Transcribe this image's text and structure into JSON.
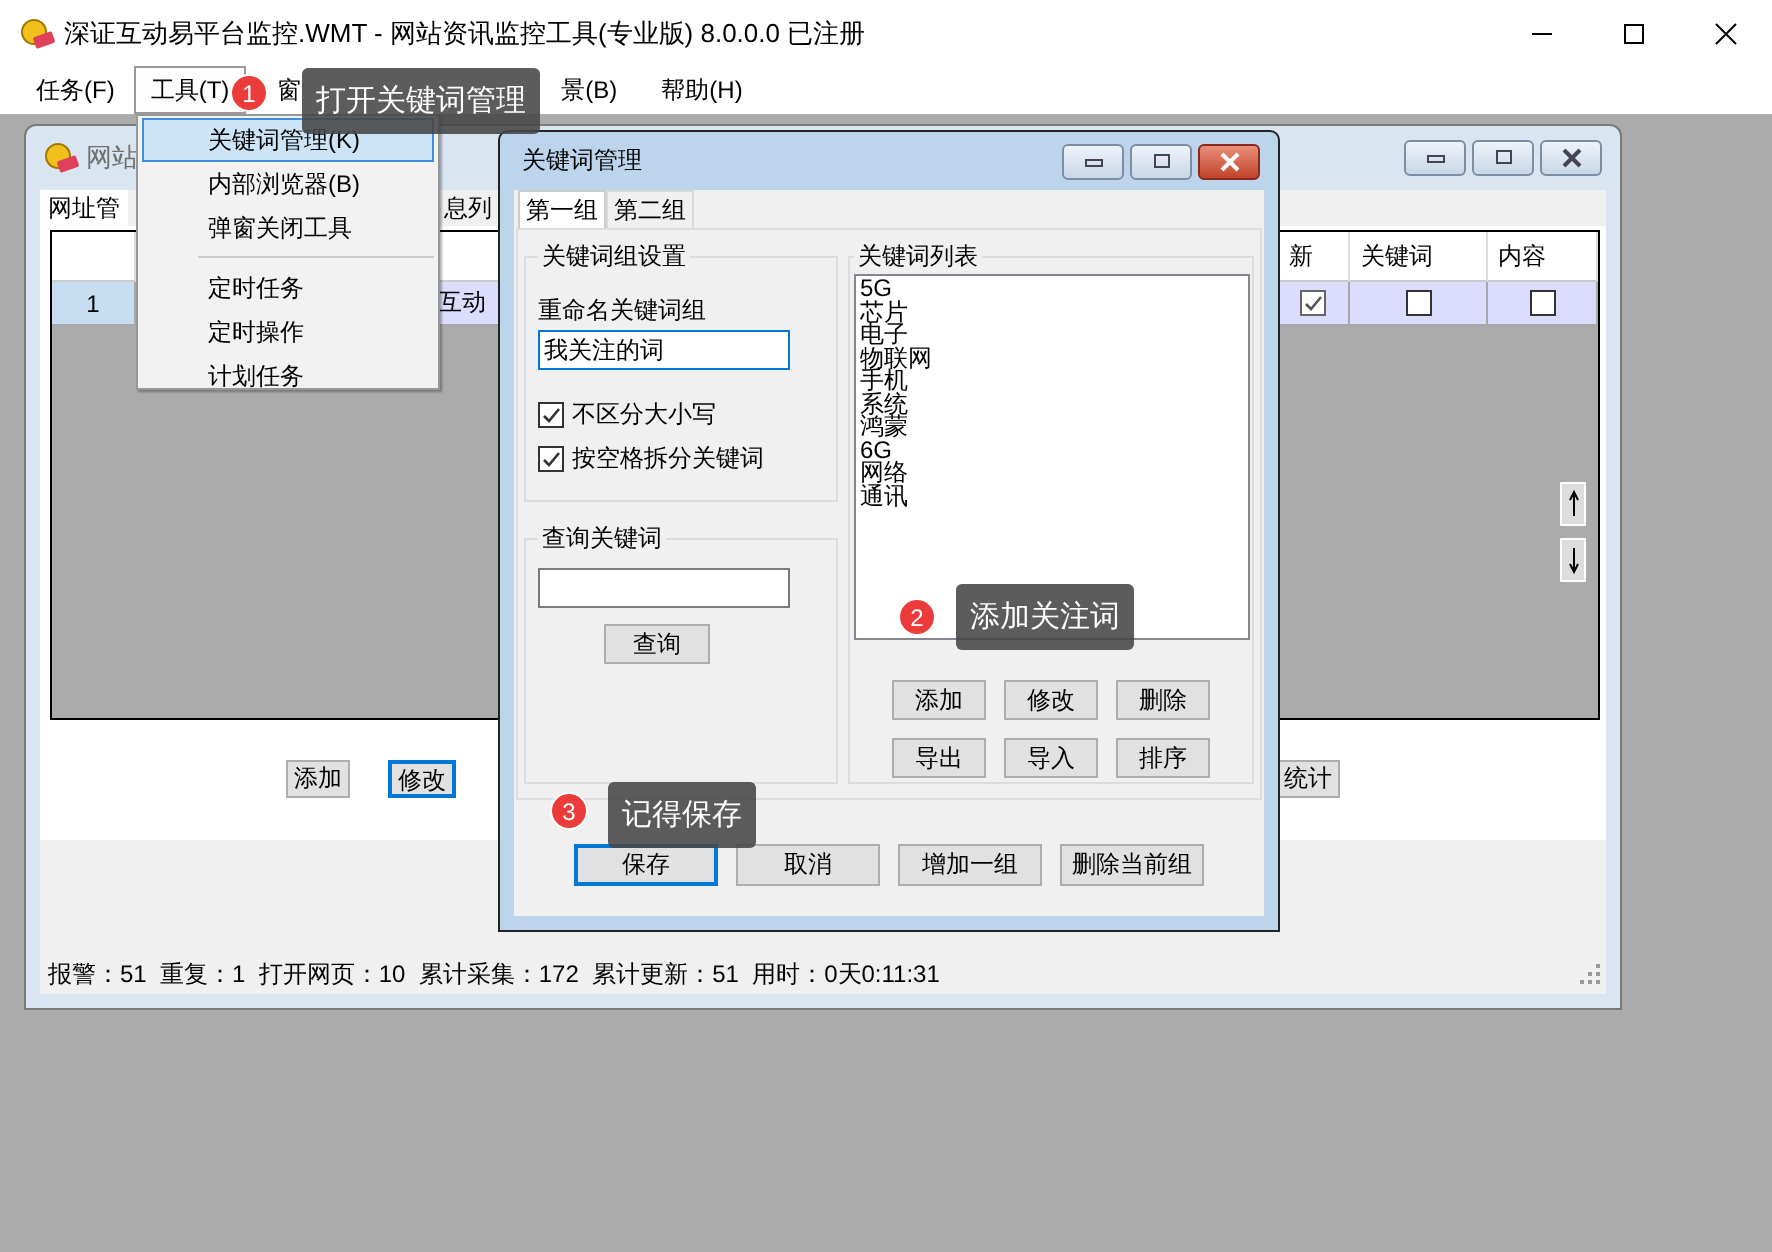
{
  "window": {
    "title": "深证互动易平台监控.WMT  - 网站资讯监控工具(专业版) 8.0.0.0  已注册"
  },
  "menu_bar": [
    {
      "label": "任务(F)",
      "selected": false
    },
    {
      "label": "工具(T)",
      "selected": true
    },
    {
      "label": "窗",
      "selected": false
    },
    {
      "label": "景(B)",
      "selected": false
    },
    {
      "label": "帮助(H)",
      "selected": false
    }
  ],
  "tools_menu": [
    {
      "kind": "item",
      "label": "关键词管理(K)",
      "selected": true
    },
    {
      "kind": "item",
      "label": "内部浏览器(B)",
      "selected": false
    },
    {
      "kind": "item",
      "label": "弹窗关闭工具",
      "selected": false
    },
    {
      "kind": "separator"
    },
    {
      "kind": "item",
      "label": "定时任务",
      "selected": false
    },
    {
      "kind": "item",
      "label": "定时操作",
      "selected": false
    },
    {
      "kind": "item",
      "label": "计划任务",
      "selected": false
    }
  ],
  "child_window": {
    "title": "网站",
    "tabs": [
      {
        "label": "网址管",
        "selected": true
      },
      {
        "label": "息列",
        "selected": false
      }
    ],
    "table": {
      "columns": [
        "新",
        "关键词",
        "内容"
      ],
      "rows": [
        {
          "number": "1",
          "cell": "互动",
          "selected": true,
          "checks": [
            true,
            false,
            false
          ]
        }
      ]
    },
    "buttons": [
      {
        "label": "添加",
        "focused": false
      },
      {
        "label": "修改",
        "focused": true
      },
      {
        "label": "统计",
        "focused": false
      }
    ],
    "status_bar": "报警：51  重复：1  打开网页：10  累计采集：172  累计更新：51  用时：0天0:11:31"
  },
  "dialog": {
    "title": "关键词管理",
    "tabs": [
      {
        "label": "第一组",
        "selected": true
      },
      {
        "label": "第二组",
        "selected": false
      }
    ],
    "group_settings": {
      "title": "关键词组设置",
      "rename_label": "重命名关键词组",
      "rename_value": "我关注的词",
      "options": [
        {
          "label": "不区分大小写",
          "checked": true
        },
        {
          "label": "按空格拆分关键词",
          "checked": true
        }
      ]
    },
    "search": {
      "title": "查询关键词",
      "button": "查询"
    },
    "keyword_list": {
      "title": "关键词列表",
      "items": [
        "5G",
        "芯片",
        "电子",
        "物联网",
        "手机",
        "系统",
        "鸿蒙",
        "6G",
        "网络",
        "通讯"
      ],
      "buttons": [
        "添加",
        "修改",
        "删除",
        "导出",
        "导入",
        "排序"
      ]
    },
    "buttons": [
      {
        "label": "保存",
        "focused": true
      },
      {
        "label": "取消",
        "focused": false
      },
      {
        "label": "增加一组",
        "focused": false
      },
      {
        "label": "删除当前组",
        "focused": false
      }
    ]
  },
  "callouts": [
    {
      "number": "1",
      "text": "打开关键词管理"
    },
    {
      "number": "2",
      "text": "添加关注词"
    },
    {
      "number": "3",
      "text": "记得保存"
    }
  ]
}
